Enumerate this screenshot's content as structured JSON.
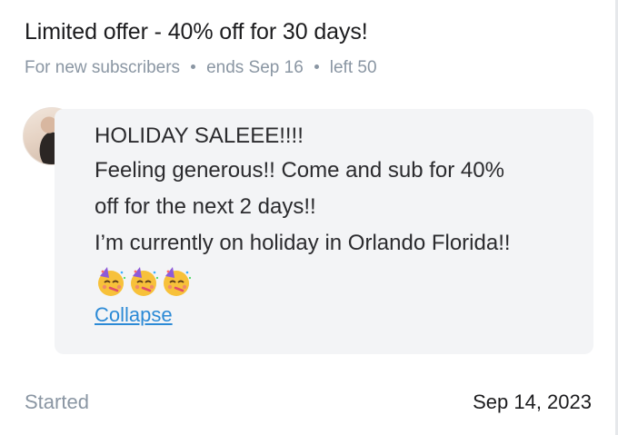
{
  "offer": {
    "title": "Limited offer - 40% off for 30 days!",
    "meta": [
      "For new subscribers",
      "ends Sep 16",
      "left 50"
    ]
  },
  "message": {
    "lines": [
      "HOLIDAY SALEEE!!!!",
      "Feeling generous!! Come and sub for 40%",
      "off for the next 2 days!!",
      "I’m currently on holiday in Orlando Florida!!"
    ],
    "emoji": [
      "partying-face",
      "partying-face",
      "partying-face"
    ],
    "collapse_label": "Collapse"
  },
  "footer": {
    "started_label": "Started",
    "started_date": "Sep 14, 2023"
  },
  "colors": {
    "link": "#2c8ad6",
    "muted": "#8a96a3",
    "bubble_bg": "#f3f4f6"
  }
}
